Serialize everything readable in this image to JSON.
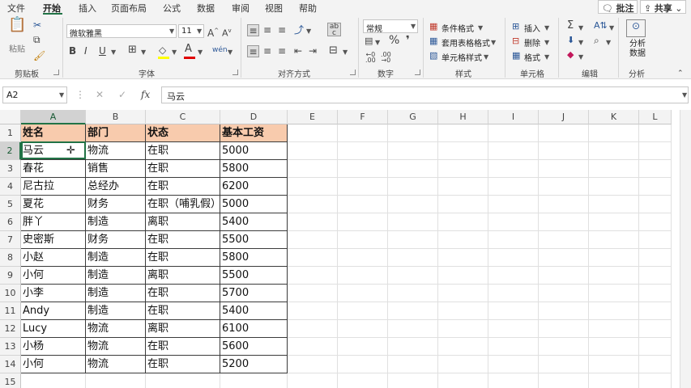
{
  "menu": {
    "tabs": [
      "文件",
      "开始",
      "插入",
      "页面布局",
      "公式",
      "数据",
      "审阅",
      "视图",
      "帮助"
    ],
    "comment_button": "批注",
    "share_button": "共享"
  },
  "ribbon": {
    "clipboard": {
      "paste_label": "粘贴",
      "group_label": "剪贴板"
    },
    "font": {
      "font_name": "微软雅黑",
      "font_size": "11",
      "bold": "B",
      "italic": "I",
      "underline": "U",
      "group_label": "字体"
    },
    "alignment": {
      "group_label": "对齐方式"
    },
    "number": {
      "format": "常规",
      "group_label": "数字"
    },
    "styles": {
      "conditional_format": "条件格式",
      "table_format": "套用表格格式",
      "cell_style": "单元格样式",
      "group_label": "样式"
    },
    "cells": {
      "insert": "插入",
      "delete": "删除",
      "format": "格式",
      "group_label": "单元格"
    },
    "editing": {
      "group_label": "编辑"
    },
    "analysis": {
      "button_label": "分析数据",
      "group_label": "分析"
    }
  },
  "formula_bar": {
    "name_box": "A2",
    "fx": "fx",
    "content": "马云"
  },
  "grid": {
    "columns": [
      "A",
      "B",
      "C",
      "D",
      "E",
      "F",
      "G",
      "H",
      "I",
      "J",
      "K",
      "L"
    ],
    "rows": [
      "1",
      "2",
      "3",
      "4",
      "5",
      "6",
      "7",
      "8",
      "9",
      "10",
      "11",
      "12",
      "13",
      "14",
      "15"
    ],
    "header": [
      "姓名",
      "部门",
      "状态",
      "基本工资"
    ],
    "data": [
      [
        "马云",
        "物流",
        "在职",
        "5000"
      ],
      [
        "春花",
        "销售",
        "在职",
        "5800"
      ],
      [
        "尼古拉",
        "总经办",
        "在职",
        "6200"
      ],
      [
        "夏花",
        "财务",
        "在职（哺乳假）",
        "5000"
      ],
      [
        "胖丫",
        "制造",
        "离职",
        "5400"
      ],
      [
        "史密斯",
        "财务",
        "在职",
        "5500"
      ],
      [
        "小赵",
        "制造",
        "在职",
        "5800"
      ],
      [
        "小何",
        "制造",
        "离职",
        "5500"
      ],
      [
        "小李",
        "制造",
        "在职",
        "5700"
      ],
      [
        "Andy",
        "制造",
        "在职",
        "5400"
      ],
      [
        "Lucy",
        "物流",
        "离职",
        "6100"
      ],
      [
        "小杨",
        "物流",
        "在职",
        "5600"
      ],
      [
        "小何",
        "物流",
        "在职",
        "5200"
      ]
    ]
  },
  "colors": {
    "accent": "#217346",
    "header_fill": "#f8cbad"
  }
}
